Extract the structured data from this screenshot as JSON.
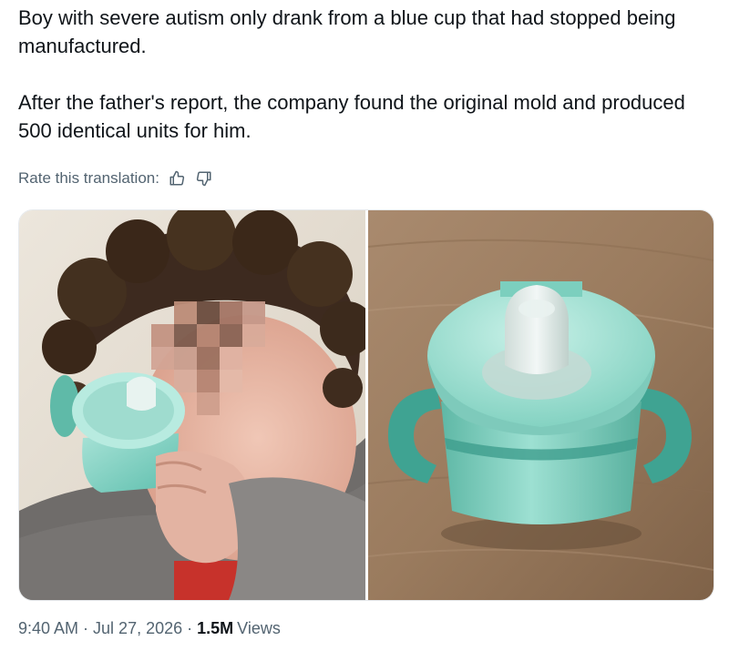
{
  "tweet": {
    "line1": "Boy with severe autism only drank from a blue cup that had stopped being manufactured.",
    "line2": "After the father's report, the company found the original mold and produced 500 identical units for him."
  },
  "translation": {
    "rate_label": "Rate this translation:",
    "thumbs_up_icon": "thumbs-up-icon",
    "thumbs_down_icon": "thumbs-down-icon"
  },
  "media": {
    "left_image": "photo of curly-haired boy with pixelated face holding a teal sippy cup",
    "right_image": "photo of a teal sippy cup with handles on a wooden table"
  },
  "meta": {
    "time": "9:40 AM",
    "separator": "·",
    "date": "Jul 27, 2026",
    "views_count": "1.5M",
    "views_label": "Views"
  },
  "colors": {
    "text_primary": "#0f1419",
    "text_secondary": "#536471",
    "cup_teal": "#5ec3b3"
  }
}
